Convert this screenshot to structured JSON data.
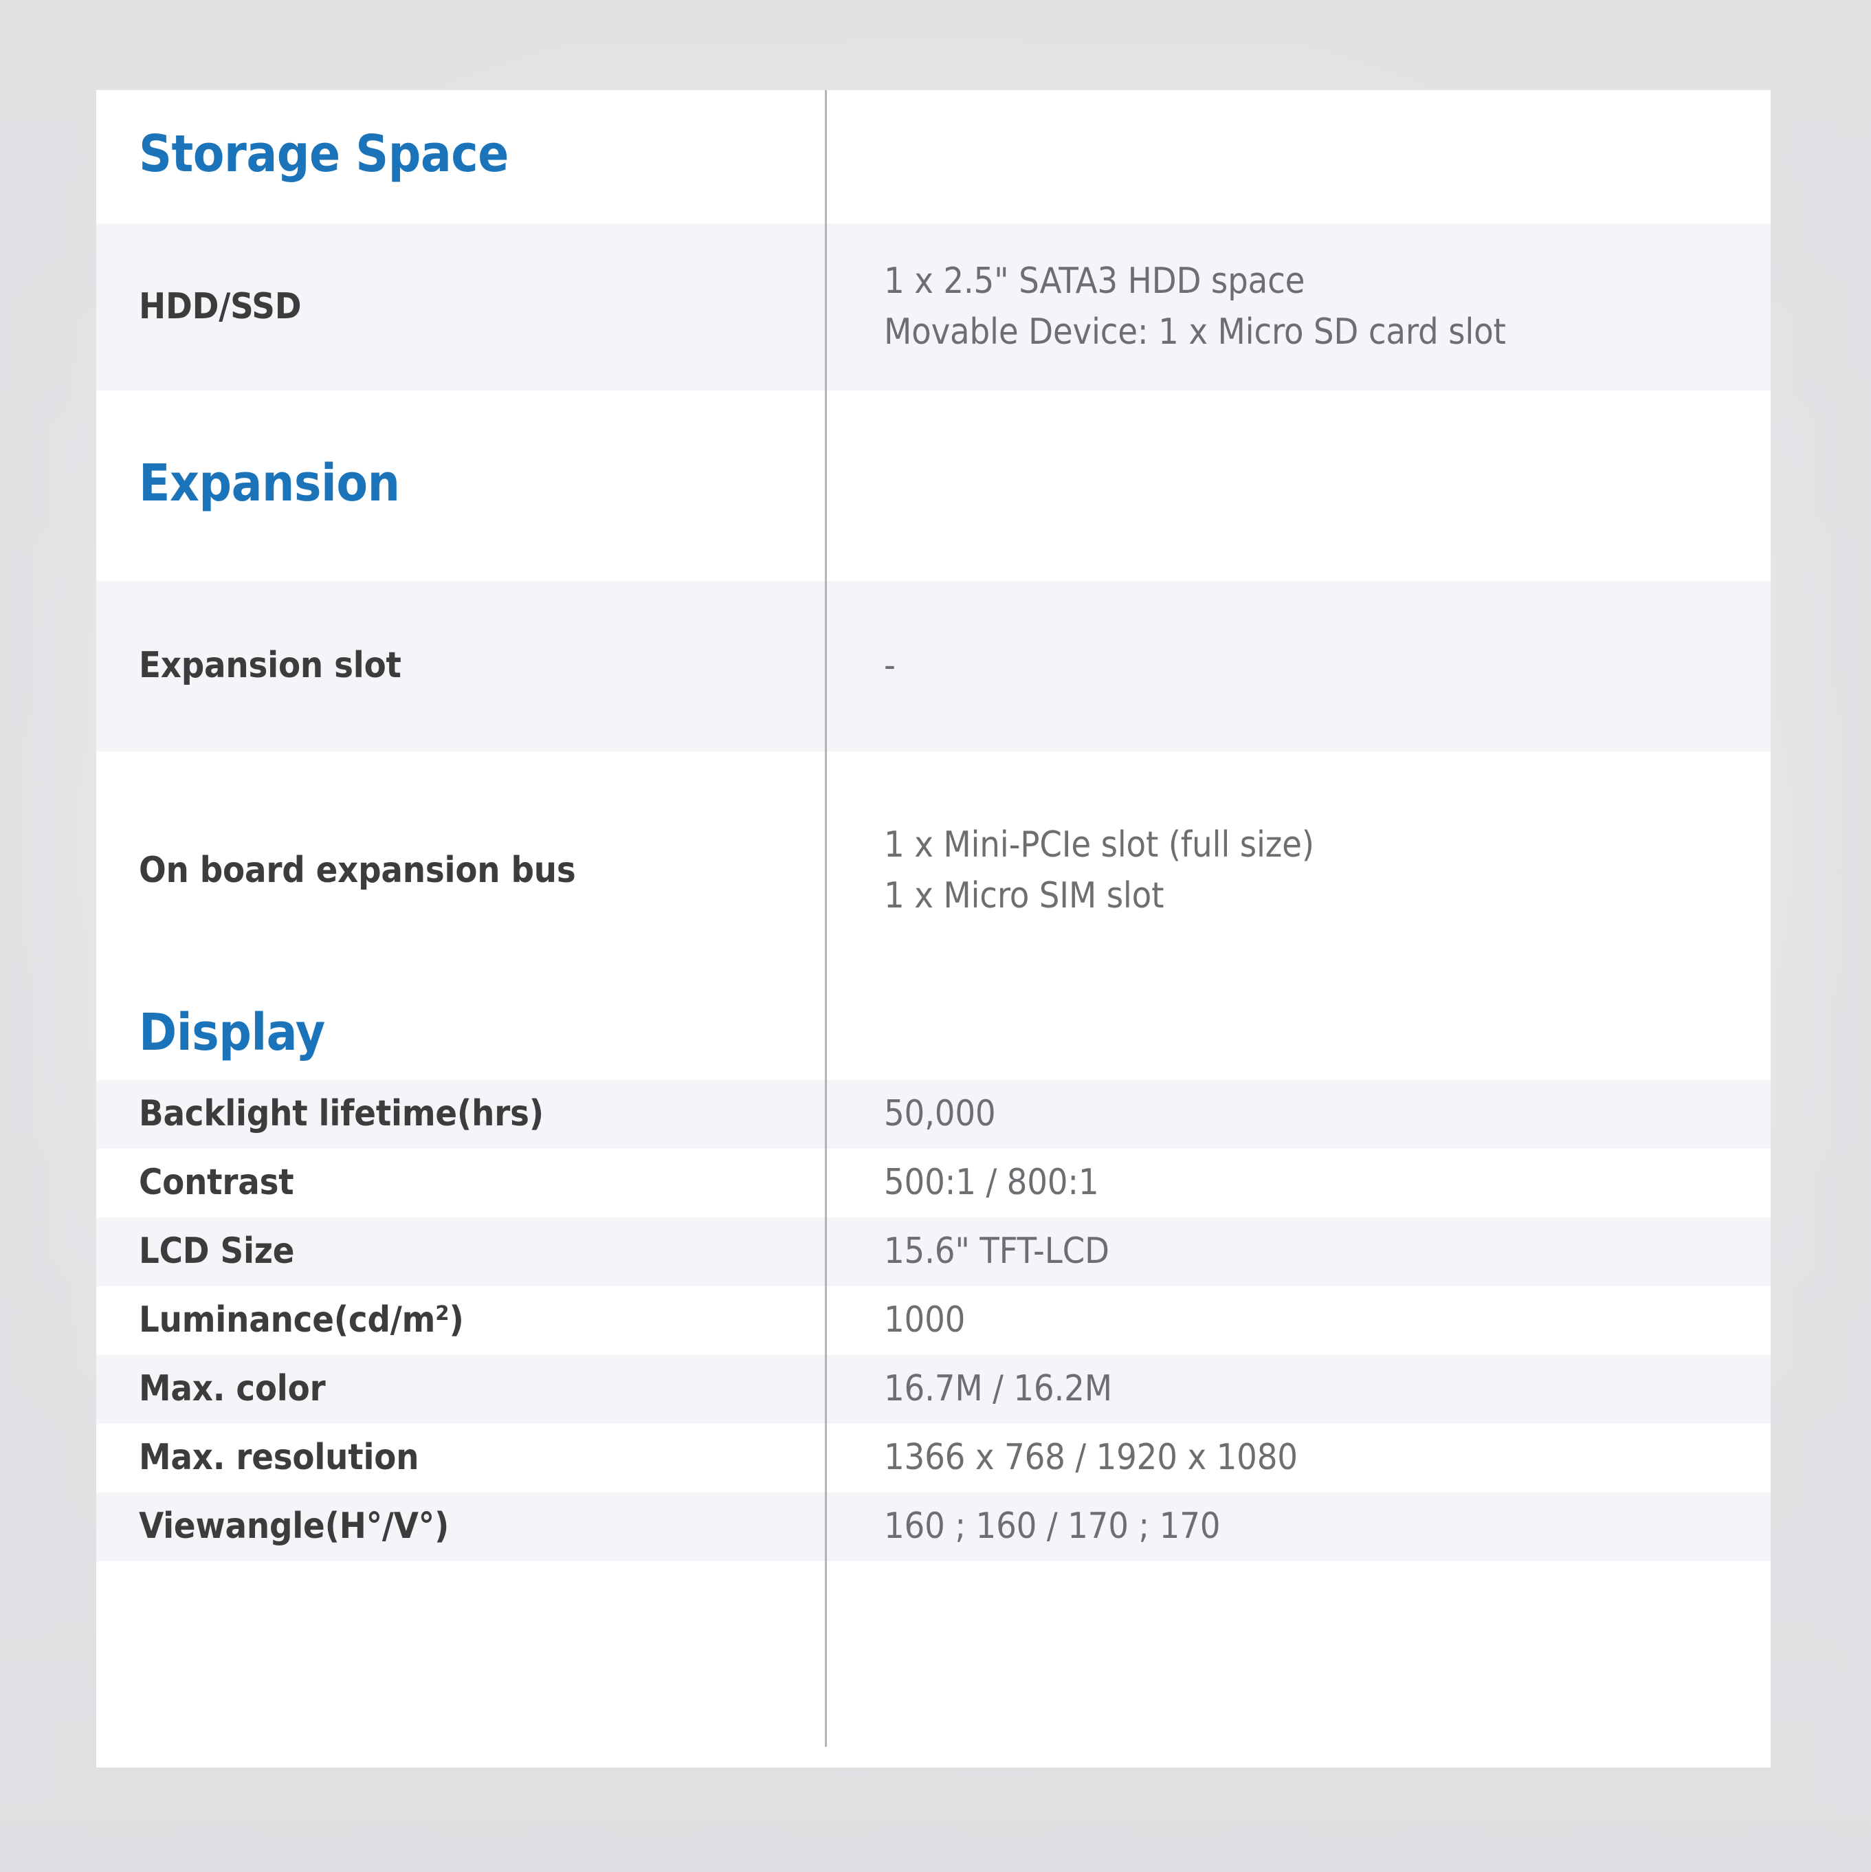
{
  "card": {
    "accent_color": "#1b74ba",
    "label_color": "#3c3c3c",
    "value_color": "#6d6e72",
    "row_alt_color": "#f4f5f8",
    "row_base_color": "#ffffff"
  },
  "sections": [
    {
      "heading": "Storage Space",
      "rows": [
        {
          "label": "HDD/SSD",
          "value_lines": [
            "1 x 2.5\" SATA3 HDD space",
            "Movable Device: 1 x Micro SD card slot"
          ]
        }
      ]
    },
    {
      "heading": "Expansion",
      "rows": [
        {
          "label": "Expansion slot",
          "value_lines": [
            "-"
          ]
        },
        {
          "label": "On board expansion bus",
          "value_lines": [
            "1 x Mini-PCIe slot (full size)",
            "1 x Micro SIM slot"
          ]
        }
      ]
    },
    {
      "heading": "Display",
      "rows": [
        {
          "label": "Backlight lifetime(hrs)",
          "value_lines": [
            "50,000"
          ]
        },
        {
          "label": "Contrast",
          "value_lines": [
            "500:1 / 800:1"
          ]
        },
        {
          "label": "LCD Size",
          "value_lines": [
            "15.6\" TFT-LCD"
          ]
        },
        {
          "label": "Luminance(cd/m²)",
          "value_lines": [
            "1000"
          ]
        },
        {
          "label": "Max. color",
          "value_lines": [
            "16.7M / 16.2M"
          ]
        },
        {
          "label": "Max. resolution",
          "value_lines": [
            "1366 x 768 / 1920 x 1080"
          ]
        },
        {
          "label": "Viewangle(H°/V°)",
          "value_lines": [
            "160 ; 160 / 170 ; 170"
          ]
        }
      ]
    }
  ]
}
